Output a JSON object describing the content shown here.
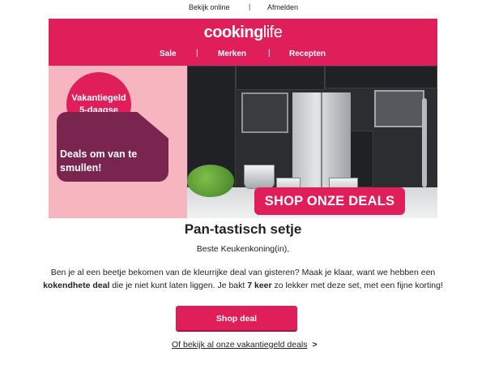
{
  "top_links": {
    "view_online": "Bekijk online",
    "separator": "|",
    "unsubscribe": "Afmelden"
  },
  "header": {
    "logo_bold": "cooking",
    "logo_light": "life",
    "nav": [
      {
        "label": "Sale"
      },
      {
        "label": "Merken"
      },
      {
        "label": "Recepten"
      }
    ],
    "nav_separator": "|"
  },
  "hero": {
    "badge_line1": "Vakantiegeld",
    "badge_line2": "5-daagse",
    "deals_line1": "Deals om van te",
    "deals_line2": "smullen!",
    "shop_deals": "SHOP ONZE DEALS"
  },
  "content": {
    "title": "Pan-tastisch setje",
    "greeting": "Beste Keukenkoning(in),",
    "body_1": "Ben je al een beetje bekomen van de kleurrijke deal van gisteren? Maak je klaar, want we hebben een",
    "body_bold_1": "kokendhete deal",
    "body_2": " die je niet kunt laten liggen. Je bakt ",
    "body_bold_2": "7 keer",
    "body_3": " zo lekker met deze set, met een fijne korting!"
  },
  "cta": {
    "button_label": "Shop deal",
    "more_label": "Of bekijk al onze vakantiegeld deals",
    "more_arrow": ">"
  },
  "colors": {
    "brand": "#e01e5a",
    "deals_box": "#7a2550",
    "hero_left_bg": "#f7b6bf"
  }
}
